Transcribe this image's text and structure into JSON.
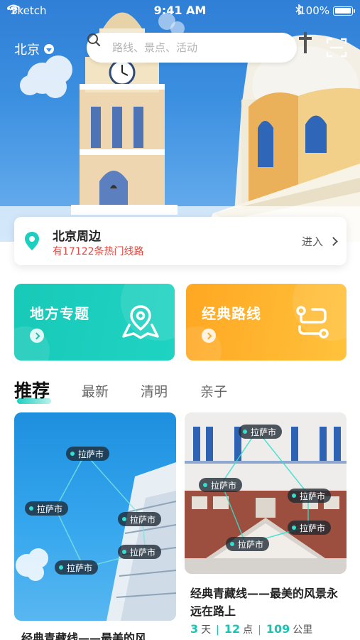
{
  "status_bar": {
    "carrier": "Sketch",
    "time": "9:41 AM",
    "battery": "100%"
  },
  "header": {
    "city": "北京",
    "search_placeholder": "路线、景点、活动"
  },
  "location_card": {
    "title": "北京周边",
    "subtitle": "有17122条热门线路",
    "action": "进入"
  },
  "tiles": [
    {
      "label": "地方专题",
      "icon": "map-pin-icon",
      "color": "#1fd3c2"
    },
    {
      "label": "经典路线",
      "icon": "route-icon",
      "color": "#ffb32e"
    }
  ],
  "tabs": [
    "推荐",
    "最新",
    "清明",
    "亲子"
  ],
  "cards": [
    {
      "title": "经典青藏线——最美的风",
      "tags": [
        "拉萨市",
        "拉萨市",
        "拉萨市",
        "拉萨市",
        "拉萨市"
      ]
    },
    {
      "title": "经典青藏线——最美的风景永远在路上",
      "tags": [
        "拉萨市",
        "拉萨市",
        "拉萨市",
        "拉萨市",
        "拉萨市"
      ],
      "days": "3",
      "days_unit": "天",
      "spots": "12",
      "spots_unit": "点",
      "km": "109",
      "km_unit": "公里"
    }
  ],
  "colors": {
    "teal": "#1fd3c2",
    "orange": "#ffb32e",
    "red": "#e8453c"
  }
}
